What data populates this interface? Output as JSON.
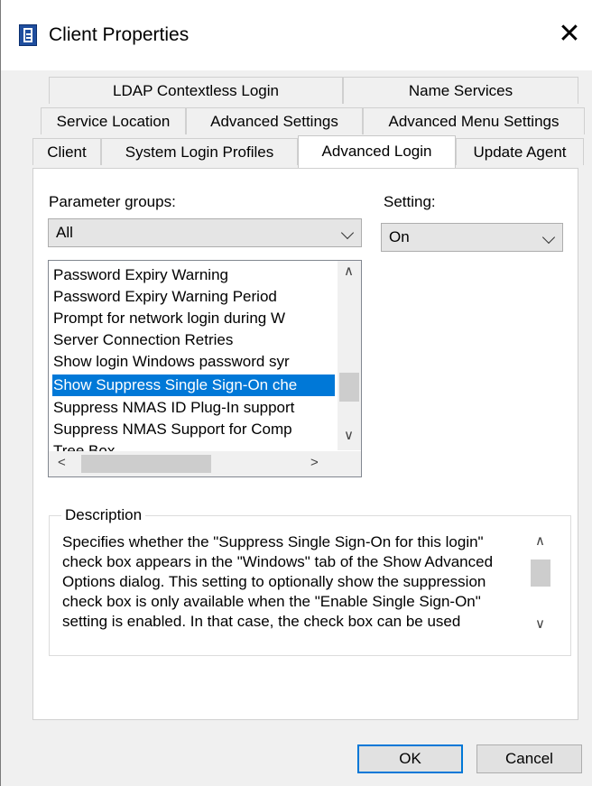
{
  "window": {
    "title": "Client Properties"
  },
  "tabs": {
    "row1": [
      "LDAP Contextless Login",
      "Name Services"
    ],
    "row2": [
      "Service Location",
      "Advanced Settings",
      "Advanced Menu Settings"
    ],
    "row3": [
      "Client",
      "System Login Profiles",
      "Advanced Login",
      "Update Agent"
    ]
  },
  "params": {
    "label": "Parameter groups:",
    "value": "All"
  },
  "setting": {
    "label": "Setting:",
    "value": "On"
  },
  "list": {
    "items": [
      "Password Expiry Warning",
      "Password Expiry Warning Period",
      "Prompt for network login during W",
      "Server Connection Retries",
      "Show login Windows password syr",
      "Show Suppress Single Sign-On che",
      "Suppress NMAS ID Plug-In support",
      "Suppress NMAS Support for Comp",
      "Tree Box"
    ],
    "selected_index": 5
  },
  "description": {
    "label": "Description",
    "text": "Specifies whether the \"Suppress Single Sign-On for this login\" check box appears in the \"Windows\" tab of the Show Advanced Options dialog.  This setting to optionally show the suppression check box is only available when the \"Enable Single Sign-On\" setting is enabled. In that case, the check box can be used"
  },
  "buttons": {
    "ok": "OK",
    "cancel": "Cancel"
  }
}
